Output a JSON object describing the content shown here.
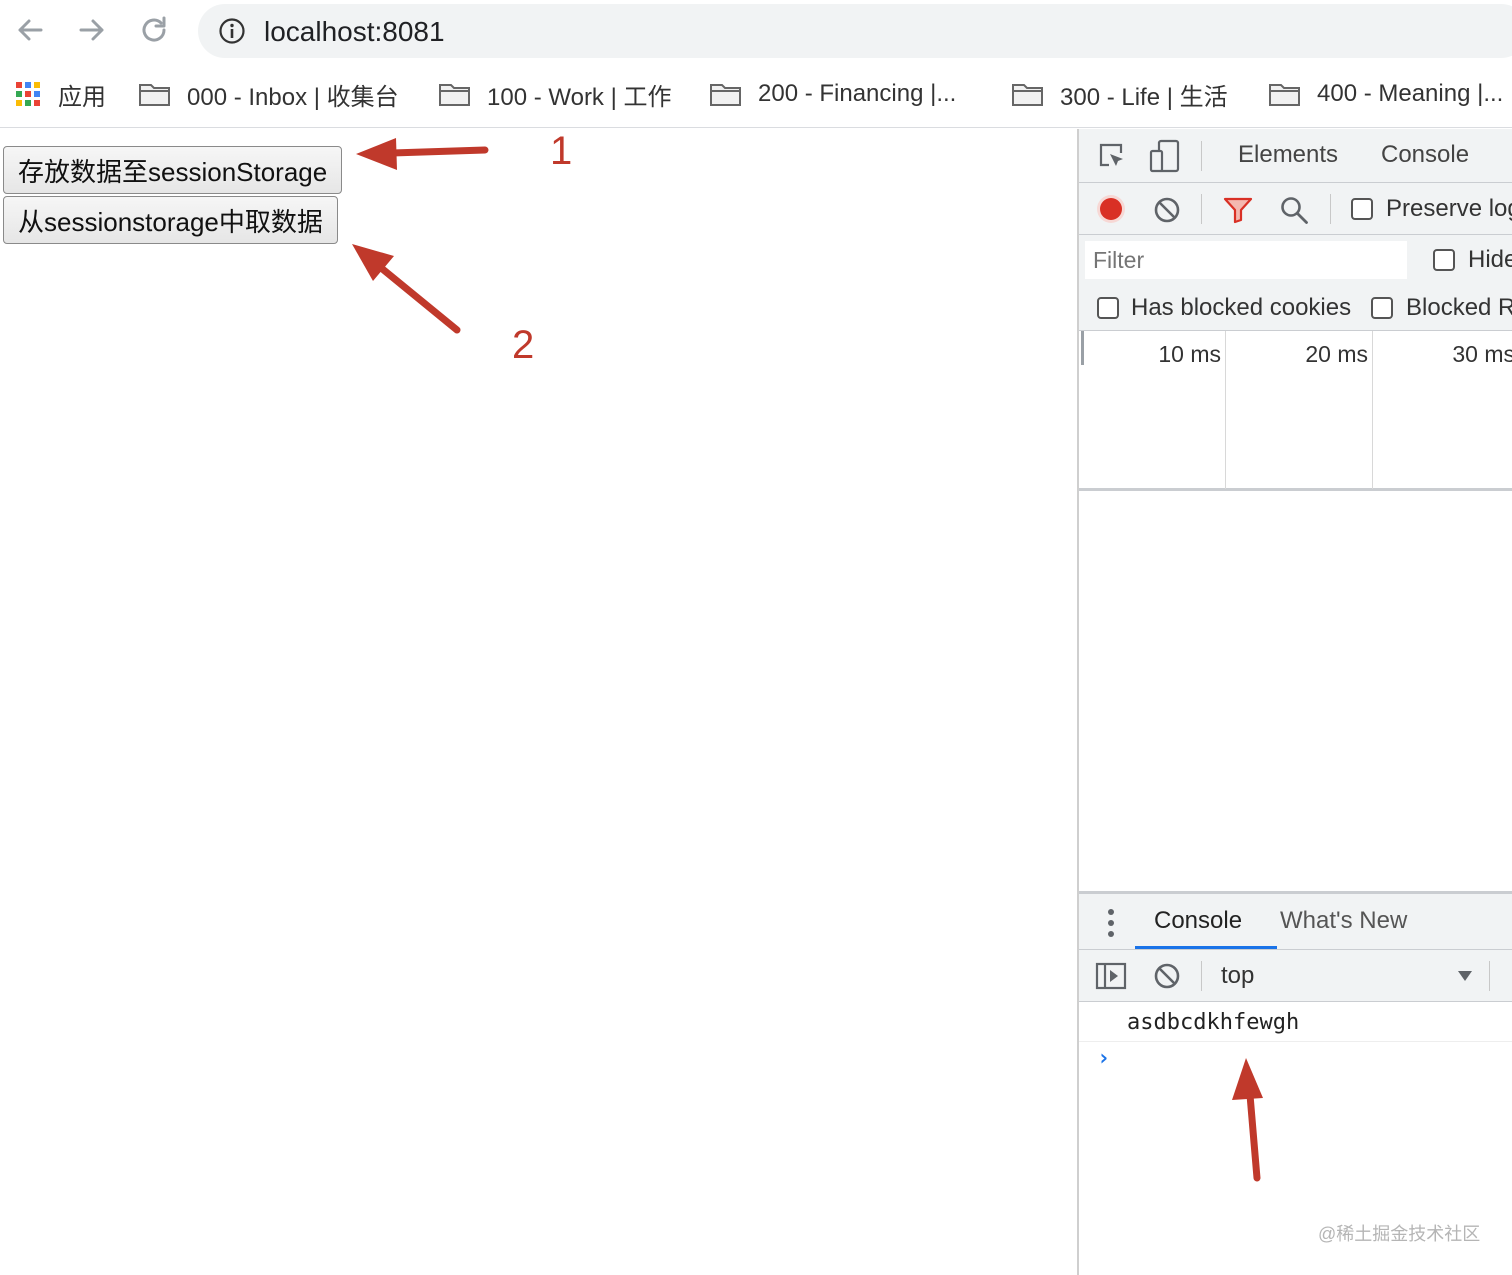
{
  "browser": {
    "url": "localhost:8081",
    "icons": {
      "back": "arrow-left-icon",
      "forward": "arrow-right-icon",
      "reload": "reload-icon",
      "site_info": "info-icon"
    }
  },
  "bookmarks": [
    {
      "label": "应用",
      "icon": "apps-grid-icon"
    },
    {
      "label": "000 - Inbox | 收集台",
      "icon": "folder-icon"
    },
    {
      "label": "100 - Work | 工作",
      "icon": "folder-icon"
    },
    {
      "label": "200 - Financing |...",
      "icon": "folder-icon"
    },
    {
      "label": "300 - Life | 生活",
      "icon": "folder-icon"
    },
    {
      "label": "400 - Meaning |...",
      "icon": "folder-icon"
    }
  ],
  "page": {
    "buttons": [
      {
        "label": "存放数据至sessionStorage"
      },
      {
        "label": "从sessionstorage中取数据"
      }
    ],
    "annotations": [
      "1",
      "2"
    ],
    "annotation_color": "#c0392b"
  },
  "devtools": {
    "tabs": [
      "Elements",
      "Console"
    ],
    "network": {
      "preserve_log_label": "Preserve log",
      "filter_placeholder": "Filter",
      "hide_label": "Hide",
      "has_blocked_cookies_label": "Has blocked cookies",
      "blocked_label": "Blocked R",
      "ticks": [
        "10 ms",
        "20 ms",
        "30 ms"
      ],
      "record_color": "#d93025"
    },
    "drawer": {
      "tabs": [
        "Console",
        "What's New"
      ],
      "context": "top",
      "output": [
        "asdbcdkhfewgh"
      ],
      "prompt": "›"
    }
  },
  "watermark": "@稀土掘金技术社区"
}
